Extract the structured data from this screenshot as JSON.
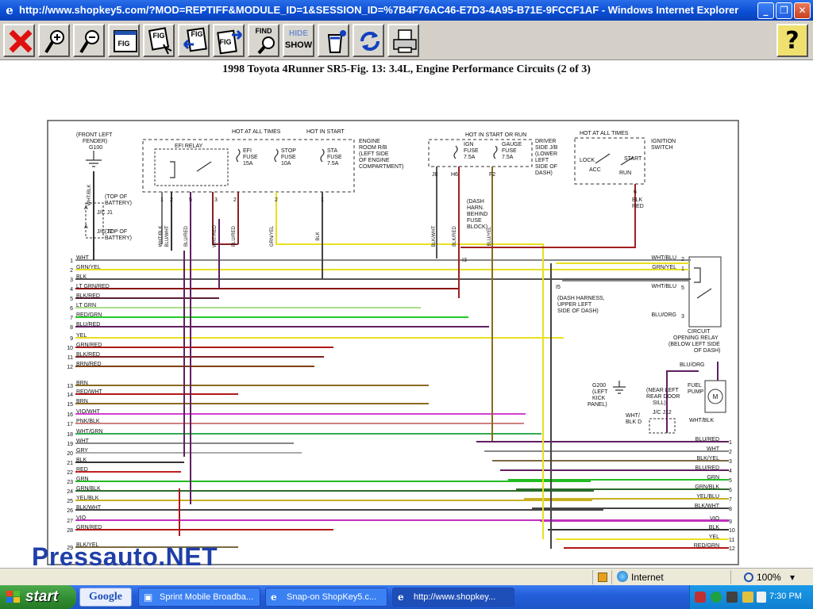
{
  "window": {
    "title": "http://www.shopkey5.com/?MOD=REPTIFF&MODULE_ID=1&SESSION_ID=%7B4F76AC46-E7D3-4A95-B71E-9FCCF1AF - Windows Internet Explorer",
    "minimize_glyph": "_",
    "restore_glyph": "❐",
    "close_glyph": "✕"
  },
  "toolbar": {
    "find_label": "FIND",
    "hide_label": "HIDE",
    "show_label": "SHOW",
    "help_label": "?",
    "fig_label": "FIG"
  },
  "figure": {
    "title": "1998 Toyota 4Runner SR5-Fig. 13: 3.4L, Engine Performance Circuits (2 of 3)",
    "labels": {
      "front_left_fender": "(FRONT LEFT",
      "fender": "FENDER)",
      "g100": "G100",
      "wht_blk": "WHT/BLK",
      "top_battery1": "(TOP OF",
      "battery1": "BATTERY)",
      "jc_j1": "J/C J1",
      "jc_j2": "J/C J2",
      "a": "A",
      "efi_relay": "EFI RELAY",
      "hot_all_times": "HOT AT ALL TIMES",
      "hot_in_start": "HOT IN START",
      "efi_fuse": "EFI",
      "efi_fuse2": "FUSE",
      "efi_amp": "15A",
      "stop_fuse": "STOP",
      "stop_fuse2": "FUSE",
      "stop_amp": "10A",
      "sta_fuse": "STA",
      "sta_fuse2": "FUSE",
      "sta_amp": "7.5A",
      "engine_room": "ENGINE",
      "engine_room2": "ROOM R/B",
      "engine_room3": "(LEFT SIDE",
      "engine_room4": "OF ENGINE",
      "engine_room5": "COMPARTMENT)",
      "hot_in_start_run": "HOT IN START OR RUN",
      "ign_fuse": "IGN",
      "ign_fuse2": "FUSE",
      "ign_amp": "7.5A",
      "gauge_fuse": "GAUGE",
      "gauge_fuse2": "FUSE",
      "gauge_amp": "7.5A",
      "driver_jb": "DRIVER",
      "driver_jb2": "SIDE J/B",
      "driver_jb3": "(LOWER",
      "driver_jb4": "LEFT",
      "driver_jb5": "SIDE OF",
      "driver_jb6": "DASH)",
      "hot_all_times2": "HOT AT ALL TIMES",
      "ignition_switch": "IGNITION",
      "ignition_switch2": "SWITCH",
      "lock": "LOCK",
      "acc": "ACC",
      "start": "START",
      "run": "RUN",
      "blk_red": "BLK/RED",
      "dash_harn": "(DASH",
      "dash_harn2": "HARN.",
      "dash_harn3": "BEHIND",
      "dash_harn4": "FUSE",
      "dash_harn5": "BLOCK)",
      "i3": "I3",
      "i5": "I5",
      "dash_harness": "(DASH HARNESS,",
      "dash_harness2": "UPPER LEFT",
      "dash_harness3": "SIDE OF DASH)",
      "cor": "CIRCUIT",
      "cor2": "OPENING RELAY",
      "cor3": "(BELOW LEFT SIDE",
      "cor4": "OF DASH)",
      "blu_org": "BLU/ORG",
      "g200": "G200",
      "g200b": "(LEFT",
      "g200c": "KICK",
      "g200d": "PANEL)",
      "near_kick": "(NEAR LEFT",
      "near_kick2": "REAR DOOR",
      "near_kick3": "SILL)",
      "jc_j12": "J/C J12",
      "fuel_pump": "FUEL",
      "fuel_pump2": "PUMP",
      "wht_blk_d": "WHT/",
      "wht_blk_d2": "BLK  D",
      "j8": "J8",
      "h6": "H6",
      "f2": "F2",
      "six": "6",
      "m": "M"
    },
    "left_wires": [
      {
        "n": "1",
        "label": "WHT"
      },
      {
        "n": "2",
        "label": "GRN/YEL"
      },
      {
        "n": "3",
        "label": "BLK"
      },
      {
        "n": "4",
        "label": "LT GRN/RED"
      },
      {
        "n": "5",
        "label": "BLK/RED"
      },
      {
        "n": "6",
        "label": "LT GRN"
      },
      {
        "n": "7",
        "label": "RED/GRN"
      },
      {
        "n": "8",
        "label": "BLU/RED"
      },
      {
        "n": "9",
        "label": "YEL"
      },
      {
        "n": "10",
        "label": "GRN/RED"
      },
      {
        "n": "11",
        "label": "BLK/RED"
      },
      {
        "n": "12",
        "label": "BRN/RED"
      },
      {
        "n": "13",
        "label": "BRN"
      },
      {
        "n": "14",
        "label": "RED/WHT"
      },
      {
        "n": "15",
        "label": "BRN"
      },
      {
        "n": "16",
        "label": "VIO/WHT"
      },
      {
        "n": "17",
        "label": "PNK/BLK"
      },
      {
        "n": "18",
        "label": "WHT/GRN"
      },
      {
        "n": "19",
        "label": "WHT"
      },
      {
        "n": "20",
        "label": "GRY"
      },
      {
        "n": "21",
        "label": "BLK"
      },
      {
        "n": "22",
        "label": "RED"
      },
      {
        "n": "23",
        "label": "GRN"
      },
      {
        "n": "24",
        "label": "GRN/BLK"
      },
      {
        "n": "25",
        "label": "YEL/BLK"
      },
      {
        "n": "26",
        "label": "BLK/WHT"
      },
      {
        "n": "27",
        "label": "VIO"
      },
      {
        "n": "28",
        "label": "GRN/RED"
      },
      {
        "n": "29",
        "label": "BLK/YEL"
      }
    ],
    "right_wires": [
      {
        "n": "1",
        "label": "BLU/RED"
      },
      {
        "n": "2",
        "label": "WHT"
      },
      {
        "n": "3",
        "label": "BLK/YEL"
      },
      {
        "n": "4",
        "label": "BLU/RED"
      },
      {
        "n": "5",
        "label": "GRN"
      },
      {
        "n": "6",
        "label": "GRN/BLK"
      },
      {
        "n": "7",
        "label": "YEL/BLU"
      },
      {
        "n": "8",
        "label": "BLK/WHT"
      },
      {
        "n": "9",
        "label": "VIO"
      },
      {
        "n": "10",
        "label": "BLK"
      },
      {
        "n": "11",
        "label": "YEL"
      },
      {
        "n": "12",
        "label": "RED/GRN"
      }
    ],
    "relay_wires": [
      {
        "n": "2",
        "label": "WHT/BLU"
      },
      {
        "n": "1",
        "label": "GRN/YEL"
      },
      {
        "n": "5",
        "label": "WHT/BLU"
      },
      {
        "n": "3",
        "label": "BLU/ORG"
      }
    ],
    "top_wires": [
      "WHT/BLK",
      "BLU/WHT",
      "BLU/RED",
      "WHT/RED",
      "BLU/RED",
      "GRN/YEL",
      "BLK",
      "BLK/WHT",
      "BLK/RED",
      "BLU/YEL"
    ],
    "pins": [
      "1",
      "2",
      "5",
      "3",
      "2",
      "2",
      "1"
    ]
  },
  "watermark": "Pressauto.NET",
  "status": {
    "zone": "Internet",
    "zoom": "100%",
    "zoom_arrow": "▾"
  },
  "taskbar": {
    "start_label": "start",
    "google_label": "Google",
    "tasks": [
      {
        "label": "Sprint Mobile Broadba..."
      },
      {
        "label": "Snap-on ShopKey5.c..."
      },
      {
        "label": "http://www.shopkey..."
      }
    ],
    "clock": "7:30 PM"
  }
}
